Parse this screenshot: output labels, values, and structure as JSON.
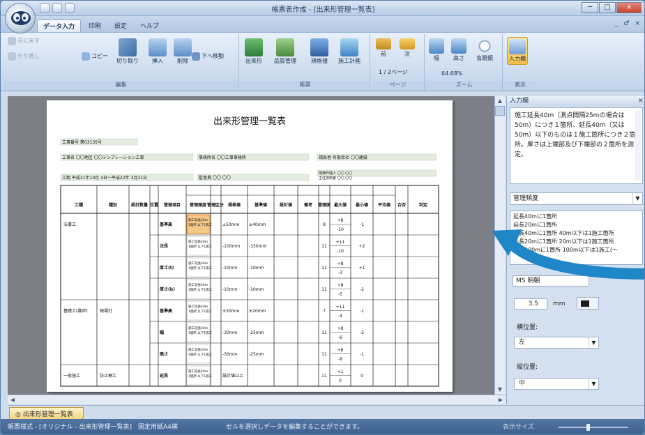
{
  "window": {
    "title": "帳票表作成 - [出来形管理一覧表]",
    "controls": [
      "─",
      "□",
      "×"
    ],
    "mdi_controls": [
      "_",
      "♂",
      "×"
    ]
  },
  "tabs": [
    "データ入力",
    "印刷",
    "設定",
    "ヘルプ"
  ],
  "ribbon": {
    "groups": [
      "編集",
      "帳票",
      "ページ",
      "ズーム",
      "表示"
    ],
    "buttons": {
      "undo": "元に戻す",
      "redo": "やり直し",
      "copy": "コピー",
      "cut": "切り取り",
      "insert": "挿入",
      "delete": "削除",
      "move_down": "下へ移動",
      "dekigata": "出来形",
      "quality": "品質管理",
      "standard": "規格値",
      "plan": "施工計画",
      "prev": "前",
      "next": "次",
      "page": "1 / 2ページ",
      "width": "幅",
      "height": "高さ",
      "zoom": "64.68%",
      "ruler": "虫眼鏡",
      "input_pane": "入力欄"
    }
  },
  "document": {
    "title": "出来形管理一覧表",
    "header": {
      "project_no": "工事番号 第03135号",
      "project_name": "工事名 〇〇地区 〇〇テンプレーション工事",
      "office": "事務所名 〇〇工事事務所",
      "contractor": "請負者 有限会社 〇〇建設",
      "period": "工期 平成21年10月 4日～平成22年 3月31日",
      "supervisor": "監督員 〇〇 〇〇",
      "manager": "現場代理人 〇〇 〇〇",
      "engineer": "主任技術者 〇〇 〇〇"
    },
    "columns": [
      "工種",
      "種別",
      "設計数量",
      "位置",
      "管理項目",
      "管理頻度",
      "管理区分",
      "規格値",
      "基準値",
      "設計値",
      "備考",
      "管理図",
      "最大値",
      "最小値",
      "平均値",
      "合否",
      "判定"
    ],
    "rows": [
      {
        "kind": "法覆工",
        "type": "",
        "item": "基準高",
        "value": "±50mm",
        "base": "±40mm",
        "n": "8",
        "max": "+8",
        "min": "-10",
        "avg": "-1"
      },
      {
        "kind": "",
        "type": "",
        "item": "法長",
        "value": "-100mm",
        "base": "-150mm",
        "n": "11",
        "max": "+11",
        "min": "-10",
        "avg": "+2"
      },
      {
        "kind": "",
        "type": "",
        "item": "厚さ(t)",
        "value": "-10mm",
        "base": "-10mm",
        "n": "11",
        "max": "+8",
        "min": "-3",
        "avg": "+1"
      },
      {
        "kind": "",
        "type": "",
        "item": "厚さ(b)",
        "value": "-10mm",
        "base": "-10mm",
        "n": "11",
        "max": "+8",
        "min": "-5",
        "avg": "-2"
      },
      {
        "kind": "基礎工(護岸)",
        "type": "現場打",
        "item": "基準高",
        "value": "±30mm",
        "base": "±20mm",
        "n": "7",
        "max": "+11",
        "min": "-4",
        "avg": "-1"
      },
      {
        "kind": "",
        "type": "",
        "item": "幅",
        "value": "-30mm",
        "base": "-25mm",
        "n": "11",
        "max": "+8",
        "min": "-6",
        "avg": "-2"
      },
      {
        "kind": "",
        "type": "",
        "item": "高さ",
        "value": "-30mm",
        "base": "-25mm",
        "n": "11",
        "max": "+8",
        "min": "-8",
        "avg": "-1"
      },
      {
        "kind": "一般施工",
        "type": "防止柵工",
        "item": "延長",
        "value": "設計値以上",
        "base": "",
        "n": "11",
        "max": "+1",
        "min": "0",
        "avg": "0"
      }
    ],
    "freq_cell": "施工延長40m 1箇所 以下1施工",
    "page_no": "1"
  },
  "side_panel": {
    "title": "入力欄",
    "close": "×",
    "description": "施工延長40m（測点間隔25mの場合は50m）につき１箇所、延長40m（又は50m）以下のものは１施工箇所につき２箇所。厚さは上端部及び下端部の２箇所を測定。",
    "combo": "管理頻度",
    "list": [
      "延長40mに1箇所",
      "延長20mに1箇所",
      "延長40mに1箇所 40m以下は1施工箇所",
      "延長20mに1箇所 20m以下は1施工箇所",
      "延長100mに1箇所 100m以下は1施工(～"
    ],
    "font": "MS 明朝",
    "size": "3.5",
    "unit": "mm",
    "h_label": "横位置:",
    "h_value": "左",
    "v_label": "縦位置:",
    "v_value": "中"
  },
  "sheet_tab": "出来形管理一覧表",
  "status": {
    "left": "帳票様式 - [オリジナル - 出来形管理一覧表]　固定用紙A4横",
    "middle": "セルを選択しデータを編集することができます。",
    "right": "表示サイズ"
  }
}
